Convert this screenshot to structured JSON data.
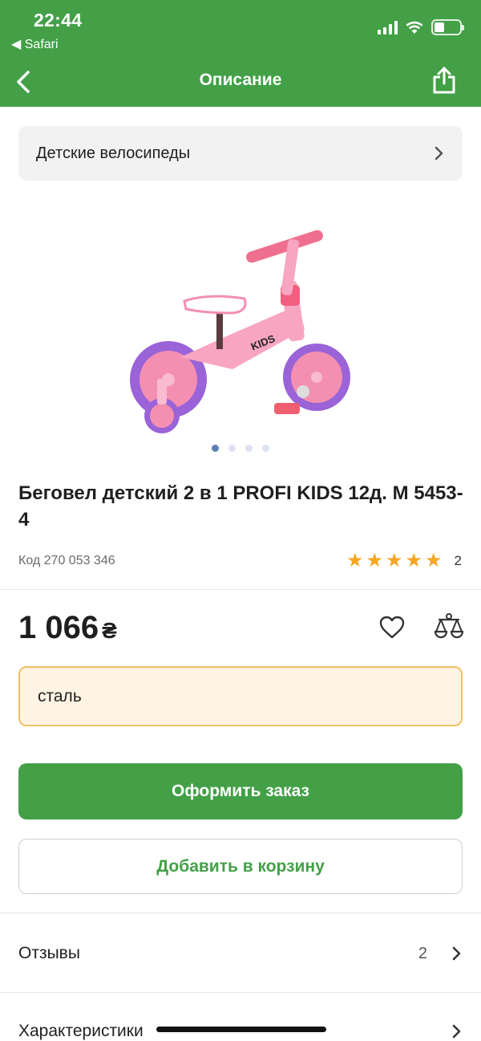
{
  "status_bar": {
    "time": "22:44",
    "back_app": "◀ Safari"
  },
  "nav": {
    "title": "Описание"
  },
  "category": {
    "label": "Детские велосипеды"
  },
  "gallery": {
    "image_count": 4,
    "active_index": 0
  },
  "product": {
    "title": "Беговел детский 2 в 1 PROFI KIDS 12д. M 5453-4",
    "code": "Код 270 053 346",
    "rating_stars": 5,
    "rating_count": "2",
    "price": "1 066",
    "currency": "₴"
  },
  "option": {
    "selected": "сталь"
  },
  "buttons": {
    "order": "Оформить заказ",
    "add_to_cart": "Добавить в корзину"
  },
  "sections": [
    {
      "label": "Отзывы",
      "count": "2"
    },
    {
      "label": "Характеристики",
      "count": ""
    }
  ],
  "colors": {
    "brand": "#43a047",
    "star": "#f6a623",
    "option_bg": "#fff4e3",
    "option_border": "#f3bf63"
  }
}
